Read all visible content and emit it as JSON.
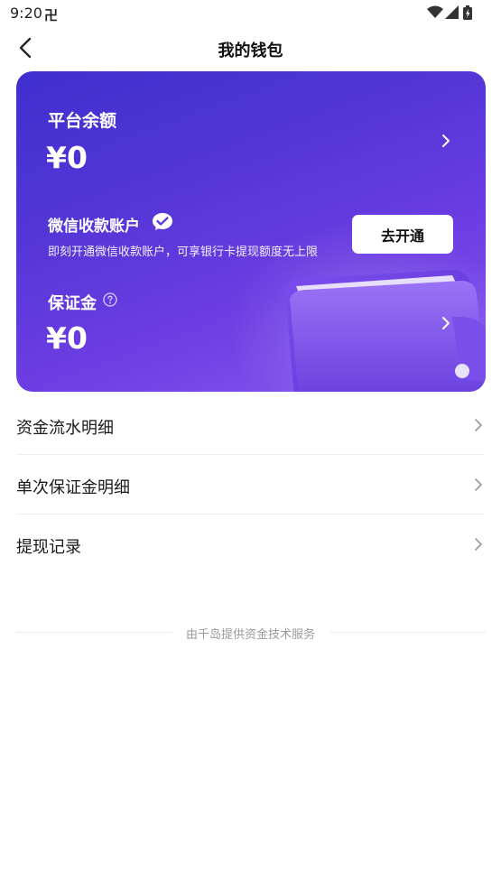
{
  "status_bar": {
    "time": "9:20",
    "carrier_icon_glyph": "卍",
    "icons": [
      "wifi-icon",
      "signal-icon",
      "battery-charging-icon"
    ]
  },
  "nav": {
    "title": "我的钱包",
    "back_icon": "chevron-left-icon"
  },
  "card": {
    "balance_label": "平台余额",
    "balance_amount": "¥0",
    "wechat_label": "微信收款账户",
    "wechat_desc": "即刻开通微信收款账户，可享银行卡提现额度无上限",
    "open_button": "去开通",
    "deposit_label": "保证金",
    "deposit_amount": "¥0",
    "colors": {
      "start": "#3e2fce",
      "end": "#8a5cf0"
    }
  },
  "menu": {
    "items": [
      {
        "label": "资金流水明细"
      },
      {
        "label": "单次保证金明细"
      },
      {
        "label": "提现记录"
      }
    ]
  },
  "footer": {
    "text": "由千岛提供资金技术服务"
  }
}
